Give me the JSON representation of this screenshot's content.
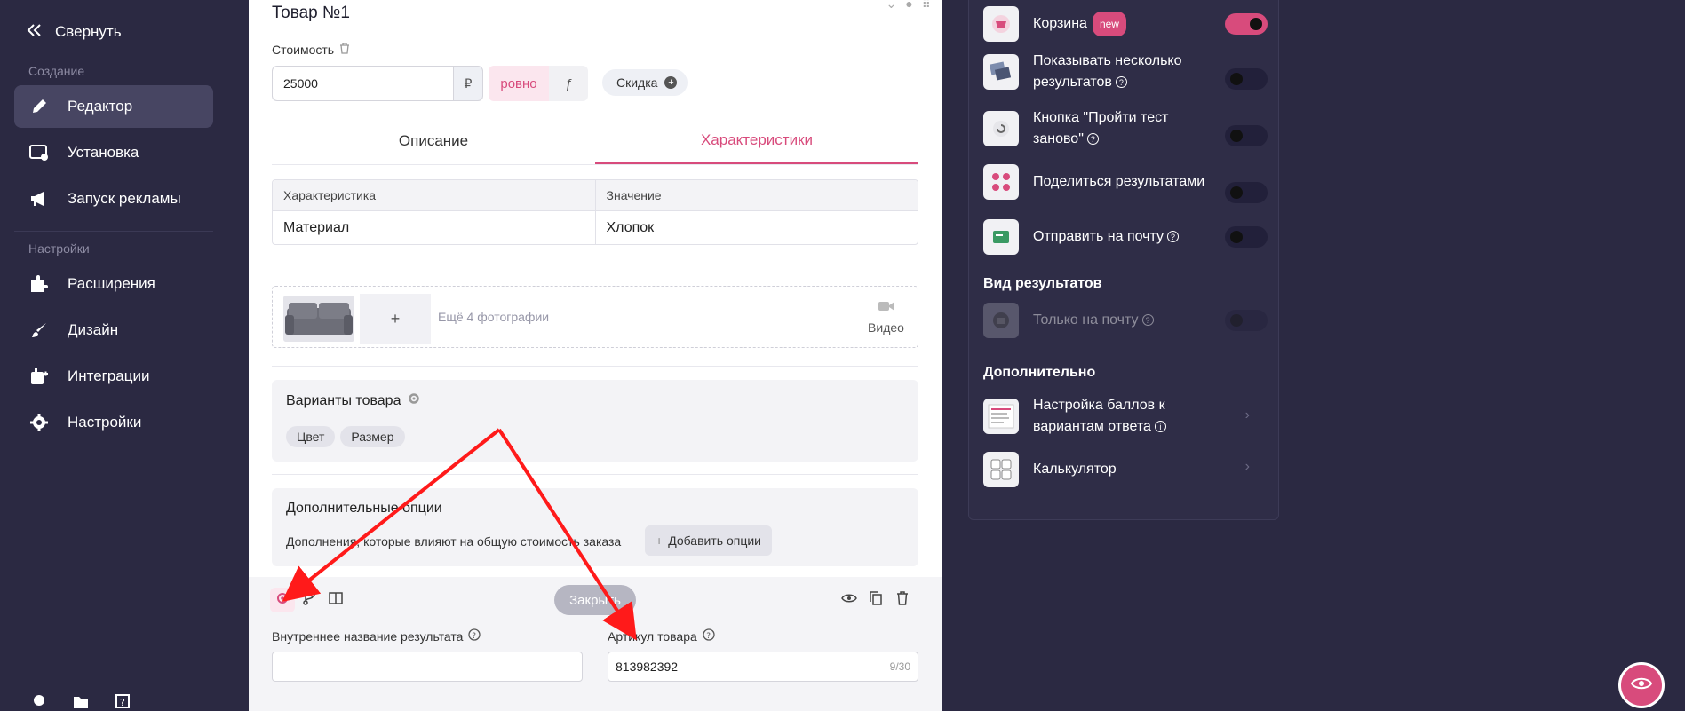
{
  "sidebar": {
    "collapse": "Свернуть",
    "section_create": "Создание",
    "section_settings": "Настройки",
    "items": [
      {
        "label": "Редактор",
        "icon": "pencil-icon"
      },
      {
        "label": "Установка",
        "icon": "install-icon"
      },
      {
        "label": "Запуск рекламы",
        "icon": "megaphone-icon"
      },
      {
        "label": "Расширения",
        "icon": "extensions-icon"
      },
      {
        "label": "Дизайн",
        "icon": "brush-icon"
      },
      {
        "label": "Интеграции",
        "icon": "integrations-icon"
      },
      {
        "label": "Настройки",
        "icon": "gear-icon"
      }
    ]
  },
  "product": {
    "title": "Товар №1",
    "cost_label": "Стоимость",
    "price": "25000",
    "currency": "₽",
    "mode": "ровно",
    "fx": "ƒ",
    "discount": "Скидка",
    "tabs": [
      "Описание",
      "Характеристики"
    ],
    "table": {
      "headers": [
        "Характеристика",
        "Значение"
      ],
      "rows": [
        [
          "Материал",
          "Хлопок"
        ]
      ]
    },
    "add_photo": "+",
    "more_photos": "Ещё 4 фотографии",
    "video": "Видео",
    "variants_title": "Варианты товара",
    "variants": [
      "Цвет",
      "Размер"
    ],
    "options_title": "Дополнительные опции",
    "options_desc": "Дополнения, которые влияют на общую стоимость заказа",
    "add_options": "Добавить опции"
  },
  "footer": {
    "close": "Закрыть",
    "internal_name_label": "Внутреннее название результата",
    "internal_name_value": "",
    "sku_label": "Артикул товара",
    "sku_value": "813982392",
    "sku_counter": "9/30"
  },
  "right_panel": {
    "cart": "Корзина",
    "new_badge": "new",
    "show_multiple": "Показывать несколько результатов",
    "retake": "Кнопка \"Пройти тест заново\"",
    "share": "Поделиться результатами",
    "send_email": "Отправить на почту",
    "view_section": "Вид результатов",
    "email_only": "Только на почту",
    "extra_section": "Дополнительно",
    "scores": "Настройка баллов к вариантам ответа",
    "calculator": "Калькулятор",
    "toggles": {
      "cart": true,
      "show_multiple": false,
      "retake": false,
      "share": false,
      "send_email": false,
      "email_only": false
    }
  },
  "colors": {
    "accent": "#d84b7c",
    "sidebar_bg": "#2b2942",
    "active_item": "#474562",
    "annotation_arrow": "#ff1a1a"
  }
}
